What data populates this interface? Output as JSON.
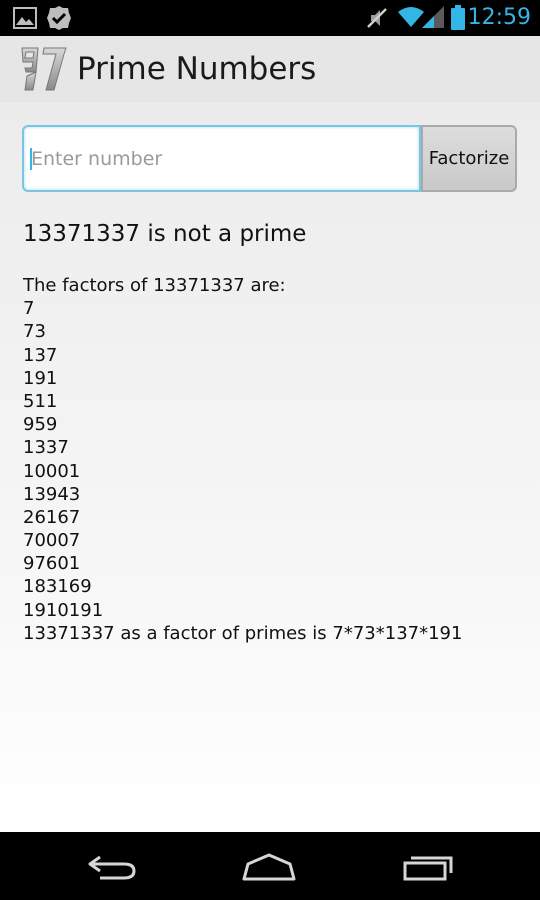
{
  "status_bar": {
    "time": "12:59",
    "icons": [
      "gallery-icon",
      "check-badge-icon",
      "mute-icon",
      "wifi-icon",
      "signal-icon",
      "battery-icon"
    ],
    "accent_color": "#33b5e5"
  },
  "action_bar": {
    "logo_icon": "prime-97-logo-icon",
    "title": "Prime Numbers"
  },
  "form": {
    "input_value": "",
    "input_placeholder": "Enter number",
    "button_label": "Factorize"
  },
  "result": {
    "heading": "13371337 is not a prime",
    "factors_intro": "The factors of 13371337 are:",
    "factors": [
      "7",
      "73",
      "137",
      "191",
      "511",
      "959",
      "1337",
      "10001",
      "13943",
      "26167",
      "70007",
      "97601",
      "183169",
      "1910191"
    ],
    "prime_factorization": "13371337 as a factor of primes is 7*73*137*191"
  },
  "nav_bar": {
    "icons": [
      "back-icon",
      "home-icon",
      "recent-apps-icon"
    ]
  }
}
